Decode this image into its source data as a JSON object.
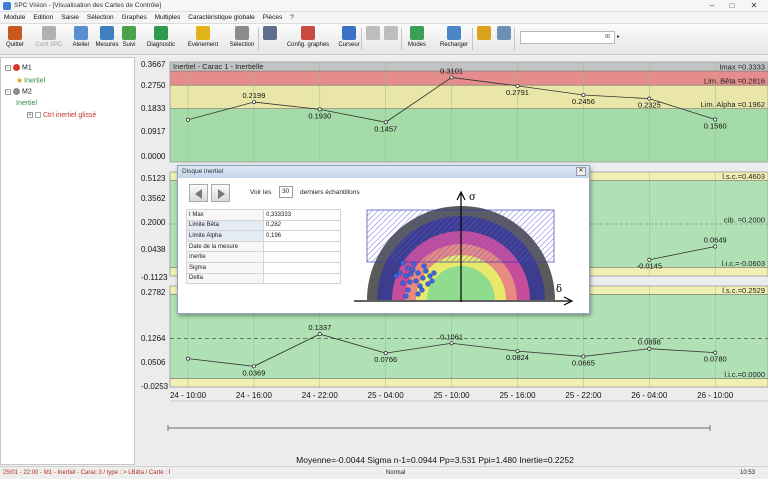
{
  "window": {
    "title": "SPC Vision - [Visualisation des Cartes de Contrôle]",
    "controls": [
      "–",
      "□",
      "✕"
    ]
  },
  "menu": [
    "Module",
    "Edition",
    "Saisie",
    "Sélection",
    "Graphes",
    "Multiples",
    "Caractéristique globale",
    "Pièces",
    "?"
  ],
  "toolbar": {
    "buttons": [
      {
        "id": "quitter",
        "label": "Quitter",
        "icon": "exit-door-icon",
        "color": "#c8581f",
        "enabled": true
      },
      {
        "id": "cont-spc",
        "label": "Cont SPC",
        "icon": "wrench-icon",
        "color": "#b0b0b0",
        "enabled": false
      },
      {
        "id": "atelier",
        "label": "Atelier",
        "icon": "worker-icon",
        "color": "#5a8fcf",
        "enabled": true
      },
      {
        "id": "mesures",
        "label": "Mesures",
        "icon": "ruler-icon",
        "color": "#3d7fc1",
        "enabled": true
      },
      {
        "id": "suivi",
        "label": "Suivi",
        "icon": "trend-chart-icon",
        "color": "#4aa34a",
        "enabled": true
      },
      {
        "id": "diagnostic",
        "label": "Diagnostic",
        "icon": "bar-chart-icon",
        "color": "#2f9a4f",
        "enabled": true
      },
      {
        "id": "evenement",
        "label": "Evénement",
        "icon": "flag-icon",
        "color": "#e3b21b",
        "enabled": true
      },
      {
        "id": "selection",
        "label": "Sélection",
        "icon": "funnel-icon",
        "color": "#8b8b8b",
        "enabled": true
      },
      {
        "id": "imprimer",
        "label": "",
        "icon": "printer-icon",
        "color": "#5d6f8a",
        "enabled": true
      },
      {
        "id": "config-graphes",
        "label": "Config. graphes",
        "icon": "palette-icon",
        "color": "#c94a3f",
        "enabled": true
      },
      {
        "id": "curseur",
        "label": "Curseur",
        "icon": "crosshair-icon",
        "color": "#3a72c4",
        "enabled": true
      },
      {
        "id": "outil-a",
        "label": "",
        "icon": "chat-icon",
        "color": "#bdbdbd",
        "enabled": false
      },
      {
        "id": "outil-b",
        "label": "",
        "icon": "chat-icon",
        "color": "#bdbdbd",
        "enabled": false
      },
      {
        "id": "modes",
        "label": "Modes",
        "icon": "chart-mode-icon",
        "color": "#3aa057",
        "enabled": true
      },
      {
        "id": "recharger",
        "label": "Recharger",
        "icon": "reload-icon",
        "color": "#4b86c8",
        "enabled": true
      },
      {
        "id": "zoom-in",
        "label": "",
        "icon": "zoom-in-icon",
        "color": "#d9a21a",
        "enabled": true
      },
      {
        "id": "zoom-out",
        "label": "",
        "icon": "zoom-out-icon",
        "color": "#6e8fb5",
        "enabled": true
      }
    ],
    "combo_value": "",
    "combo_button": "⊞"
  },
  "tree": [
    {
      "label": "M1",
      "level": 0,
      "kind": "machine",
      "color": "#d9362b",
      "toggle": "−"
    },
    {
      "label": "Inertiel",
      "level": 1,
      "kind": "star",
      "color": "#2e8b3e"
    },
    {
      "label": "M2",
      "level": 0,
      "kind": "machine",
      "color": "#8c8c8c",
      "toggle": "−"
    },
    {
      "label": "Inertiel",
      "level": 1,
      "kind": "leaf",
      "color": "#2e8b3e"
    },
    {
      "label": "Ctrl inertiel glissé",
      "level": 2,
      "kind": "box",
      "color": "#c0392b",
      "toggle": "+"
    }
  ],
  "charts": [
    {
      "id": "chart-1",
      "title": "Inertiel - Carac 1 - Inertielle",
      "yticks": [
        "0.3667",
        "0.2750",
        "0.1833",
        "0.0917",
        "0.0000"
      ],
      "ylim": [
        0,
        0.3667
      ],
      "limits": [
        {
          "label": "Imax =0.3333",
          "value": 0.3333
        },
        {
          "label": "Lim. Bêta =0.2816",
          "value": 0.2816
        },
        {
          "label": "Lim. Alpha =0.1962",
          "value": 0.1962
        }
      ],
      "points": [
        {
          "x": 0,
          "y": 0.155,
          "label": ""
        },
        {
          "x": 1,
          "y": 0.2199,
          "label": "0.2199"
        },
        {
          "x": 2,
          "y": 0.193,
          "label": "0.1930"
        },
        {
          "x": 3,
          "y": 0.1457,
          "label": "0.1457"
        },
        {
          "x": 4,
          "y": 0.3101,
          "label": "0.3101"
        },
        {
          "x": 5,
          "y": 0.2791,
          "label": "0.2791"
        },
        {
          "x": 6,
          "y": 0.2456,
          "label": "0.2456"
        },
        {
          "x": 7,
          "y": 0.2325,
          "label": "0.2325"
        },
        {
          "x": 8,
          "y": 0.156,
          "label": "0.1560"
        }
      ]
    },
    {
      "id": "chart-2",
      "yticks": [
        "0.5123",
        "0.3562",
        "0.2000",
        "0.0438",
        "-0.1123"
      ],
      "ylim": [
        -0.1123,
        0.5123
      ],
      "limits": [
        {
          "label": "l.s.c.=0.4603",
          "value": 0.4603
        },
        {
          "label": "cib. =0.2000",
          "value": 0.2
        },
        {
          "label": "l.i.c.=-0.0603",
          "value": -0.0603
        }
      ],
      "points": [
        {
          "x": 7,
          "y": -0.0145,
          "label": "-0.0145"
        },
        {
          "x": 8,
          "y": 0.0649,
          "label": "0.0649"
        }
      ]
    },
    {
      "id": "chart-3",
      "yticks": [
        "0.2782",
        "0.1264",
        "0.0506",
        "-0.0253"
      ],
      "ylim": [
        -0.0253,
        0.2782
      ],
      "limits": [
        {
          "label": "l.s.c.=0.2529",
          "value": 0.2529
        },
        {
          "label": "l.i.c.=0.0000",
          "value": 0.0
        }
      ],
      "points": [
        {
          "x": 0,
          "y": 0.06,
          "label": ""
        },
        {
          "x": 1,
          "y": 0.0369,
          "label": "0.0369"
        },
        {
          "x": 2,
          "y": 0.1337,
          "label": "0.1337"
        },
        {
          "x": 3,
          "y": 0.0766,
          "label": "0.0766"
        },
        {
          "x": 4,
          "y": 0.1061,
          "label": "0.1061"
        },
        {
          "x": 5,
          "y": 0.0824,
          "label": "0.0824"
        },
        {
          "x": 6,
          "y": 0.0665,
          "label": "0.0665"
        },
        {
          "x": 7,
          "y": 0.0898,
          "label": "0.0898"
        },
        {
          "x": 8,
          "y": 0.078,
          "label": "0.0780"
        }
      ]
    }
  ],
  "xaxis_labels": [
    "24 - 10:00",
    "24 - 16:00",
    "24 - 22:00",
    "25 - 04:00",
    "25 - 10:00",
    "25 - 16:00",
    "25 - 22:00",
    "26 - 04:00",
    "26 - 10:00"
  ],
  "stats_line": "Moyenne=-0.0044  Sigma n-1=0.0944  Pp=3.531  Ppi=1.480  Inertie=0.2252",
  "dialog": {
    "title": "Disque inertiel",
    "close": "✕",
    "voir_les": "Voir les",
    "n_value": "30",
    "derniers": "derniers échantillons",
    "rows": [
      {
        "key": "I Max",
        "value": "0,333333"
      },
      {
        "key": "Limite Bêta",
        "value": "0,282"
      },
      {
        "key": "Limite Alpha",
        "value": "0,196"
      },
      {
        "key": "Date de la mesure",
        "value": ""
      },
      {
        "key": "Inertie",
        "value": ""
      },
      {
        "key": "Sigma",
        "value": ""
      },
      {
        "key": "Delta",
        "value": ""
      }
    ],
    "sigma_symbol": "σ",
    "delta_symbol": "δ"
  },
  "status": {
    "left": "25/01 - 22:00 - M1 - Inertiel - Carac 3 / type : > LBêta / Carte : I",
    "mode": "Normal",
    "time": "10:53"
  }
}
